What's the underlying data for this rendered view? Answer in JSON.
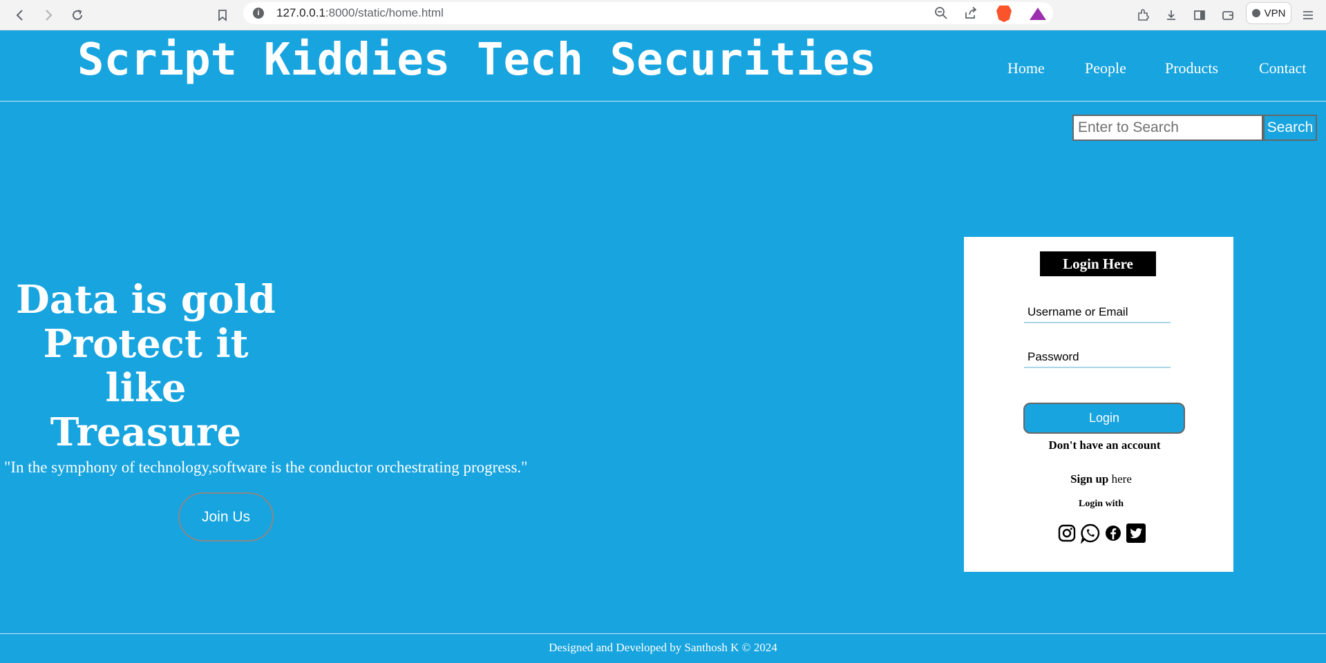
{
  "browser": {
    "url_host": "127.0.0.1",
    "url_rest": ":8000/static/home.html",
    "info_glyph": "i",
    "vpn_label": "VPN"
  },
  "header": {
    "brand": "Script Kiddies Tech Securities",
    "nav": [
      "Home",
      "People",
      "Products",
      "Contact"
    ]
  },
  "search": {
    "placeholder": "Enter to Search",
    "button": "Search"
  },
  "hero": {
    "line1": "Data is gold",
    "line2": "Protect it like",
    "line3": "Treasure",
    "quote": "\"In the symphony of technology,software is the conductor orchestrating progress.\"",
    "join_button": "Join Us"
  },
  "login": {
    "title": "Login Here",
    "username_placeholder": "Username or Email",
    "password_placeholder": "Password",
    "button": "Login",
    "no_account": "Don't have an account",
    "signup_bold": "Sign up",
    "signup_rest": " here",
    "login_with": "Login with",
    "socials": [
      "instagram-icon",
      "whatsapp-icon",
      "facebook-icon",
      "twitter-icon"
    ]
  },
  "footer": {
    "text": "Designed and Developed by Santhosh K © 2024"
  },
  "colors": {
    "page_bg": "#17a4df",
    "text": "#ffffff",
    "card_bg": "#ffffff",
    "title_bg": "#000000"
  }
}
